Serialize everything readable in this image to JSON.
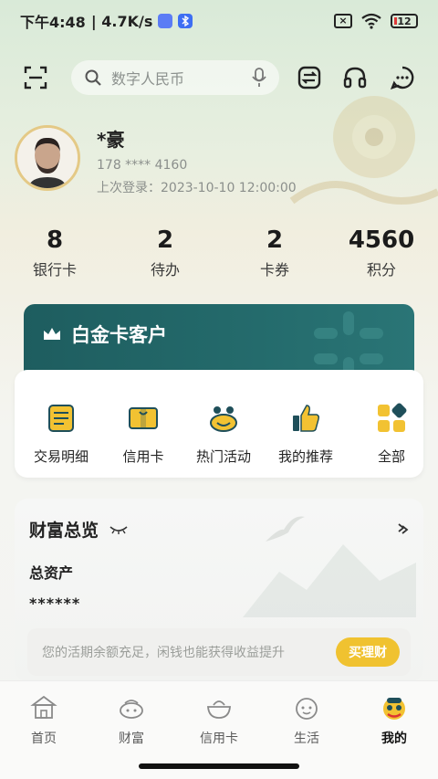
{
  "status_bar": {
    "time": "下午4:48",
    "network_speed": "| 4.7K/s",
    "battery_level": "12"
  },
  "top_nav": {
    "search_placeholder": "数字人民币",
    "icons": [
      "scan-icon",
      "search-icon",
      "mic-icon",
      "transfer-icon",
      "headset-icon",
      "message-icon"
    ]
  },
  "profile": {
    "name": "*豪",
    "phone": "178 **** 4160",
    "last_login": "上次登录：2023-10-10 12:00:00"
  },
  "stats": [
    {
      "value": "8",
      "label": "银行卡"
    },
    {
      "value": "2",
      "label": "待办"
    },
    {
      "value": "2",
      "label": "卡券"
    },
    {
      "value": "4560",
      "label": "积分"
    }
  ],
  "vip_card": {
    "title": "白金卡客户",
    "color": "#1e5d5f"
  },
  "quick_actions": [
    {
      "label": "交易明细",
      "icon": "transaction-list-icon"
    },
    {
      "label": "信用卡",
      "icon": "credit-card-icon"
    },
    {
      "label": "热门活动",
      "icon": "hot-activity-icon"
    },
    {
      "label": "我的推荐",
      "icon": "thumbs-up-icon"
    },
    {
      "label": "全部",
      "icon": "grid-icon"
    }
  ],
  "wealth": {
    "title": "财富总览",
    "assets_label": "总资产",
    "assets_value": "******",
    "promo_text": "您的活期余额充足，闲钱也能获得收益提升",
    "promo_button": "买理财"
  },
  "tabbar": [
    {
      "label": "首页",
      "icon": "home-building-icon"
    },
    {
      "label": "财富",
      "icon": "wealth-icon"
    },
    {
      "label": "信用卡",
      "icon": "credit-bowl-icon"
    },
    {
      "label": "生活",
      "icon": "life-face-icon"
    },
    {
      "label": "我的",
      "icon": "lion-dance-icon",
      "active": true
    }
  ],
  "colors": {
    "accent_gold": "#f0c230",
    "vip_teal": "#1e5d5f",
    "icon_yellow": "#f2c232",
    "icon_teal": "#1f4f5a"
  }
}
